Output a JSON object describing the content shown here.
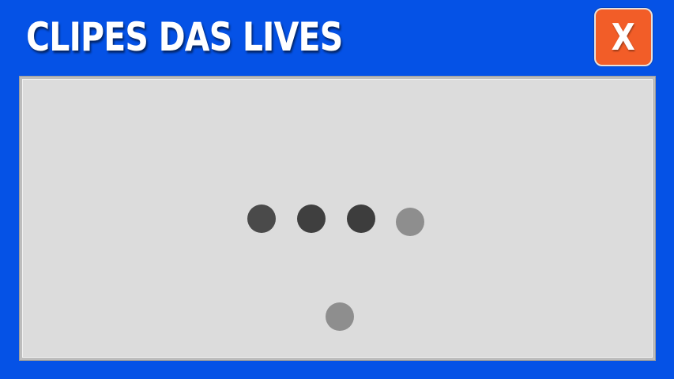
{
  "header": {
    "title": "CLIPES DAS LIVES",
    "close_label": "X"
  },
  "loader": {
    "status": "loading",
    "dots": [
      {
        "shade": "dark",
        "color": "#4a4a4a"
      },
      {
        "shade": "darkest",
        "color": "#3f3f3f"
      },
      {
        "shade": "darkest",
        "color": "#3d3d3d"
      },
      {
        "shade": "light",
        "color": "#8e8e8e"
      },
      {
        "shade": "light",
        "color": "#8e8e8e"
      }
    ]
  },
  "colors": {
    "background": "#0552e6",
    "panel": "#dcdcdc",
    "close_button": "#f25d28",
    "title_text": "#ffffff"
  }
}
